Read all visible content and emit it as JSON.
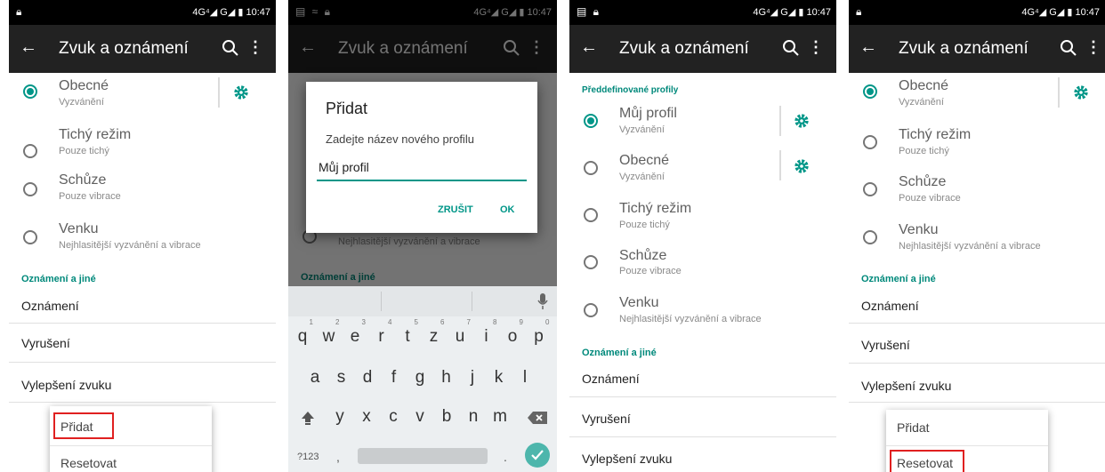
{
  "status_bar": {
    "network": "4G⁴◢ G◢ ▮",
    "time": "10:47"
  },
  "appbar": {
    "title": "Zvuk a oznámení",
    "back_icon": "arrow-back-icon",
    "search_icon": "search-icon",
    "more_icon": "more-vert-icon"
  },
  "colors": {
    "accent": "#009688",
    "appbar": "#222222",
    "highlight": "#e02020"
  },
  "profiles": [
    {
      "name": "Obecné",
      "sub": "Vyzvánění"
    },
    {
      "name": "Tichý režim",
      "sub": "Pouze tichý"
    },
    {
      "name": "Schůze",
      "sub": "Pouze vibrace"
    },
    {
      "name": "Venku",
      "sub": "Nejhlasitější vyzvánění a vibrace"
    }
  ],
  "predefined": {
    "header": "Předdefinované profily",
    "my_profile": {
      "name": "Můj profil",
      "sub": "Vyzvánění"
    }
  },
  "section_title": "Oznámení a jiné",
  "menu_items": [
    "Oznámení",
    "Vyrušení",
    "Vylepšení zvuku"
  ],
  "popup": {
    "add": "Přidat",
    "reset": "Resetovat"
  },
  "dialog": {
    "title": "Přidat",
    "message": "Zadejte název nového profilu",
    "input_value": "Můj profil",
    "cancel": "ZRUŠIT",
    "ok": "OK"
  },
  "keyboard": {
    "row1": [
      "q",
      "w",
      "e",
      "r",
      "t",
      "z",
      "u",
      "i",
      "o",
      "p"
    ],
    "row1_numbers": [
      "1",
      "2",
      "3",
      "4",
      "5",
      "6",
      "7",
      "8",
      "9",
      "0"
    ],
    "row2": [
      "a",
      "s",
      "d",
      "f",
      "g",
      "h",
      "j",
      "k",
      "l"
    ],
    "row3": [
      "y",
      "x",
      "c",
      "v",
      "b",
      "n",
      "m"
    ],
    "symbols_key": "?123",
    "comma": ",",
    "period": "."
  }
}
